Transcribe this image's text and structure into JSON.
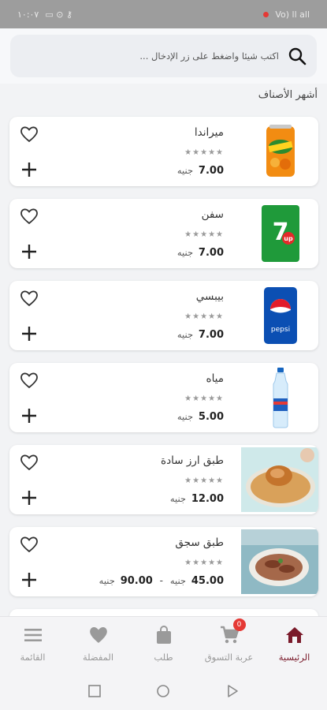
{
  "status_bar": {
    "time": "١٠:٠٧",
    "right_text": "Vo) ll all"
  },
  "search": {
    "placeholder": "اكتب شيئا واضغط على زر الإدخال ..."
  },
  "section": {
    "title": "أشهر الأصناف"
  },
  "products": [
    {
      "name": "ميراندا",
      "stars": "★★★★★",
      "price": "7.00",
      "currency": "جنيه",
      "image": "mirinda-can"
    },
    {
      "name": "سفن",
      "stars": "★★★★★",
      "price": "7.00",
      "currency": "جنيه",
      "image": "7up-can"
    },
    {
      "name": "بيبسي",
      "stars": "★★★★★",
      "price": "7.00",
      "currency": "جنيه",
      "image": "pepsi-can"
    },
    {
      "name": "مياه",
      "stars": "★★★★★",
      "price": "5.00",
      "currency": "جنيه",
      "image": "water-bottle"
    },
    {
      "name": "طبق ارز سادة",
      "stars": "★★★★★",
      "price": "12.00",
      "currency": "جنيه",
      "image": "rice-chicken-dish"
    },
    {
      "name": "طبق سجق",
      "stars": "★★★★★",
      "price": "45.00",
      "currency": "جنيه",
      "price_old": "90.00",
      "currency_old": "جنيه",
      "separator": "-",
      "image": "sausage-dish"
    }
  ],
  "bottom_nav": {
    "items": [
      {
        "label": "القائمة",
        "icon": "menu-icon"
      },
      {
        "label": "المفضلة",
        "icon": "heart-icon"
      },
      {
        "label": "طلب",
        "icon": "bag-icon"
      },
      {
        "label": "عربة التسوق",
        "icon": "cart-icon",
        "badge": "0"
      },
      {
        "label": "الرئيسية",
        "icon": "home-icon",
        "active": true
      }
    ]
  },
  "colors": {
    "accent": "#7a1a2a",
    "badge": "#e53935",
    "background": "#f2f3f5"
  }
}
